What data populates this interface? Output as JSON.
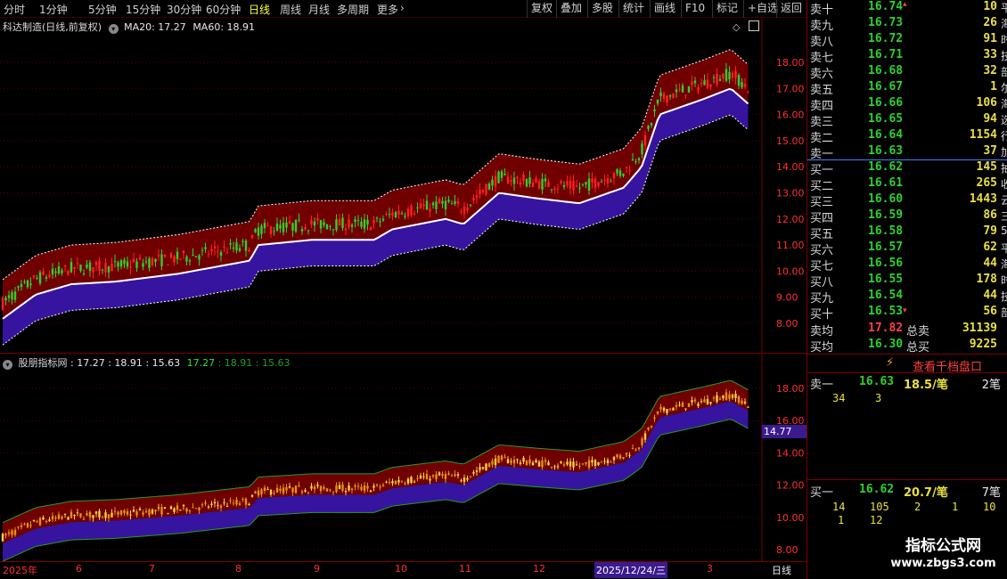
{
  "toolbar": {
    "tabs": [
      "分时",
      "1分钟",
      "5分钟",
      "15分钟",
      "30分钟",
      "60分钟",
      "日线",
      "周线",
      "月线",
      "多周期",
      "更多"
    ],
    "active_tab": "日线",
    "right_buttons": [
      "复权",
      "叠加",
      "多股",
      "统计",
      "画线",
      "F10",
      "标记",
      "+自选",
      "返回"
    ]
  },
  "main_chart": {
    "caption_name": "科达制造(日线,前复权)",
    "ma_label_1": "MA20: 17.27",
    "ma_label_2": "MA60: 18.91",
    "y_ticks": [
      "18.00",
      "17.00",
      "16.00",
      "15.00",
      "14.00",
      "13.00",
      "12.00",
      "11.00",
      "10.00",
      "9.00",
      "8.00"
    ]
  },
  "indicator_chart": {
    "caption_name": "股朋指标网",
    "values_white": ": 17.27  : 18.91  : 15.63",
    "values_green": "17.27",
    "values_darkgreen": ": 18.91  : 15.63",
    "y_ticks": [
      "18.00",
      "16.00",
      "14.00",
      "12.00",
      "10.00",
      "8.00"
    ],
    "crosshair_value": "14.77"
  },
  "x_axis": {
    "labels": [
      "2025年",
      "6",
      "7",
      "8",
      "9",
      "10",
      "11",
      "12",
      "2025/12/24/三",
      "3"
    ],
    "period": "日线"
  },
  "order_book": {
    "asks": [
      {
        "label": "卖十",
        "price": "16.74",
        "vol": "10"
      },
      {
        "label": "卖九",
        "price": "16.73",
        "vol": "26"
      },
      {
        "label": "卖八",
        "price": "16.72",
        "vol": "91"
      },
      {
        "label": "卖七",
        "price": "16.71",
        "vol": "33"
      },
      {
        "label": "卖六",
        "price": "16.68",
        "vol": "32"
      },
      {
        "label": "卖五",
        "price": "16.67",
        "vol": "1"
      },
      {
        "label": "卖四",
        "price": "16.66",
        "vol": "106"
      },
      {
        "label": "卖三",
        "price": "16.65",
        "vol": "94"
      },
      {
        "label": "卖二",
        "price": "16.64",
        "vol": "1154"
      },
      {
        "label": "卖一",
        "price": "16.63",
        "vol": "37"
      }
    ],
    "bids": [
      {
        "label": "买一",
        "price": "16.62",
        "vol": "145"
      },
      {
        "label": "买二",
        "price": "16.61",
        "vol": "265"
      },
      {
        "label": "买三",
        "price": "16.60",
        "vol": "1443"
      },
      {
        "label": "买四",
        "price": "16.59",
        "vol": "86"
      },
      {
        "label": "买五",
        "price": "16.58",
        "vol": "79"
      },
      {
        "label": "买六",
        "price": "16.57",
        "vol": "62"
      },
      {
        "label": "买七",
        "price": "16.56",
        "vol": "44"
      },
      {
        "label": "买八",
        "price": "16.55",
        "vol": "178"
      },
      {
        "label": "买九",
        "price": "16.54",
        "vol": "44"
      },
      {
        "label": "买十",
        "price": "16.53",
        "vol": "56"
      }
    ],
    "side_chars": [
      "平",
      "海",
      "时",
      "技",
      "部",
      "尔",
      "海",
      "选",
      "行",
      "加",
      "抽",
      "收",
      "云",
      "三",
      "5"
    ],
    "sell_avg_label": "卖均",
    "sell_avg": "17.82",
    "total_sell_label": "总卖",
    "total_sell": "31139",
    "buy_avg_label": "买均",
    "buy_avg": "16.30",
    "total_buy_label": "总买",
    "total_buy": "9225",
    "depth_link": "查看千档盘口",
    "sell1_label": "卖一",
    "sell1_price": "16.63",
    "sell1_avg": "18.5/笔",
    "sell1_count": "2笔",
    "sell1_queue": [
      "34",
      "3"
    ],
    "buy1_label": "买一",
    "buy1_price": "16.62",
    "buy1_avg": "20.7/笔",
    "buy1_count": "7笔",
    "buy1_queue_row1": [
      "14",
      "105",
      "2",
      "1",
      "10"
    ],
    "buy1_queue_row2": [
      "1",
      "12"
    ]
  },
  "watermark": {
    "line1": "指标公式网",
    "line2": "www.zbgs3.com"
  },
  "colors": {
    "band_upper": "#7a0000",
    "band_lower": "#3a14a8",
    "up": "#ff3030",
    "down": "#2ed12e",
    "ma": "#ffffff",
    "axis": "#ff3030"
  }
}
